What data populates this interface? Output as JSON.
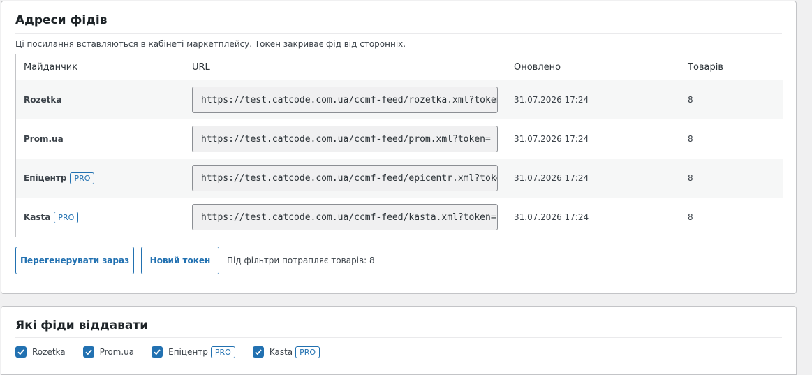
{
  "feeds_section": {
    "title": "Адреси фідів",
    "description": "Ці посилання вставляються в кабінеті маркетплейсу. Токен закриває фід від сторонніх.",
    "table": {
      "headers": [
        "Майданчик",
        "URL",
        "Оновлено",
        "Товарів"
      ],
      "rows": [
        {
          "name": "Rozetka",
          "pro": false,
          "pro_label": "",
          "url": "https://test.catcode.com.ua/ccmf-feed/rozetka.xml?token=",
          "updated": "31.07.2026 17:24",
          "count": "8"
        },
        {
          "name": "Prom.ua",
          "pro": false,
          "pro_label": "",
          "url": "https://test.catcode.com.ua/ccmf-feed/prom.xml?token=",
          "updated": "31.07.2026 17:24",
          "count": "8"
        },
        {
          "name": "Епіцентр",
          "pro": true,
          "pro_label": "PRO",
          "url": "https://test.catcode.com.ua/ccmf-feed/epicentr.xml?token=",
          "updated": "31.07.2026 17:24",
          "count": "8"
        },
        {
          "name": "Kasta",
          "pro": true,
          "pro_label": "PRO",
          "url": "https://test.catcode.com.ua/ccmf-feed/kasta.xml?token=",
          "updated": "31.07.2026 17:24",
          "count": "8"
        }
      ]
    },
    "buttons": {
      "regenerate": "Перегенерувати зараз",
      "new_token": "Новий токен"
    },
    "filter_note": "Під фільтри потрапляє товарів: 8"
  },
  "which_section": {
    "title": "Які фіди віддавати",
    "checkboxes": [
      {
        "label": "Rozetka",
        "checked": true,
        "pro_label": ""
      },
      {
        "label": "Prom.ua",
        "checked": true,
        "pro_label": ""
      },
      {
        "label": "Епіцентр",
        "checked": true,
        "pro_label": "PRO"
      },
      {
        "label": "Kasta",
        "checked": true,
        "pro_label": "PRO"
      }
    ]
  },
  "colors": {
    "accent": "#2271b1",
    "border": "#c3c4c7",
    "stripe": "#f6f7f7",
    "input_bg": "#f0f0f1"
  },
  "icons": {
    "checkbox": "checkmark-icon"
  }
}
